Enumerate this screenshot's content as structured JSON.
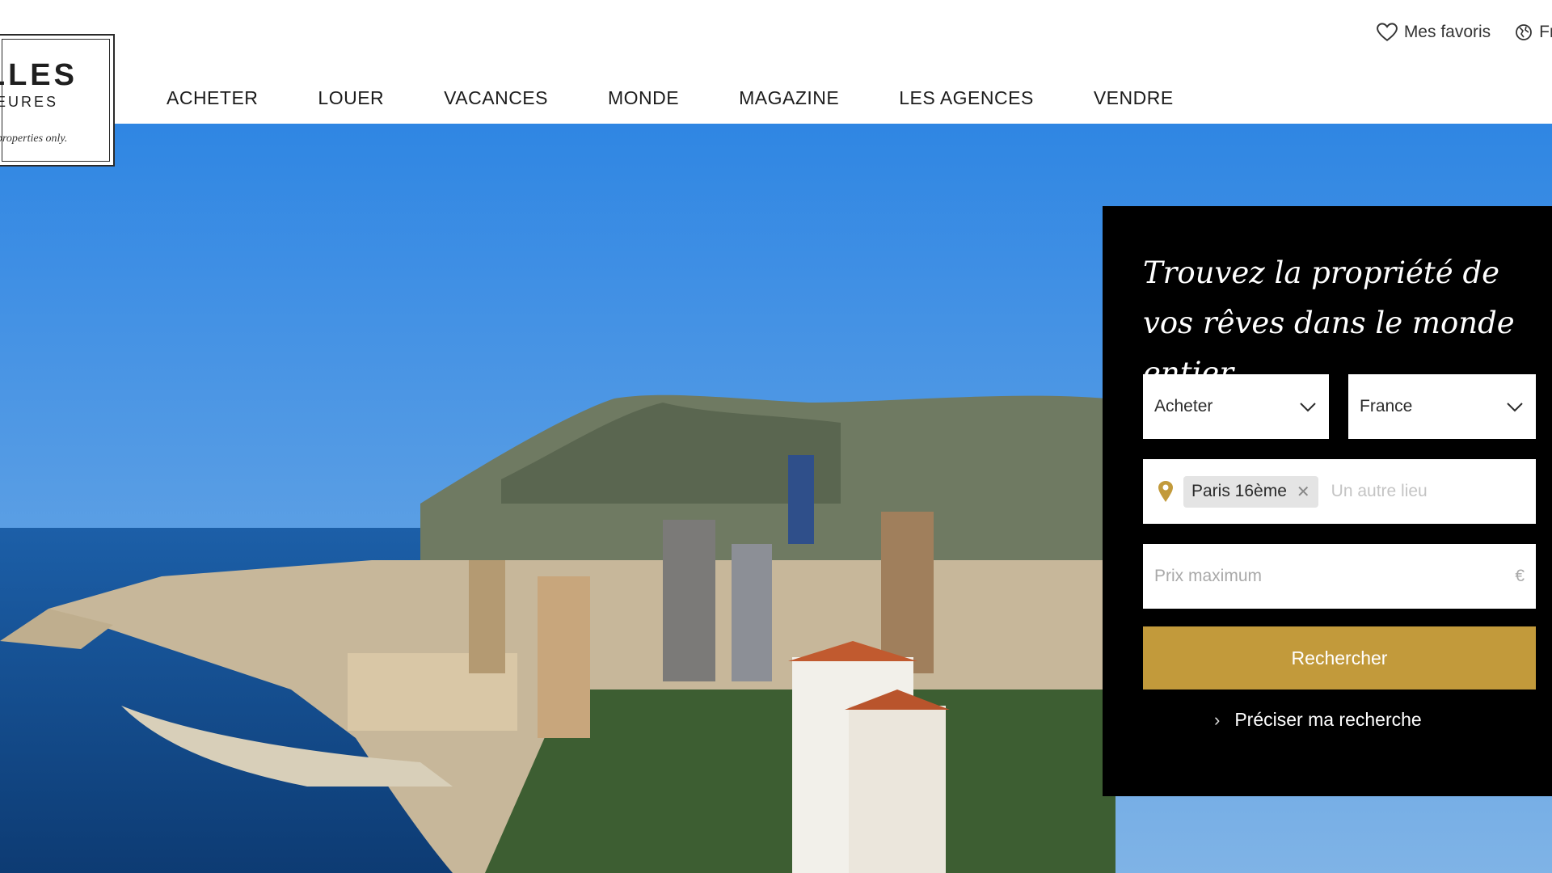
{
  "brand": {
    "word_line1": "LLES",
    "word_line2": "EURES",
    "tagline": "properties only."
  },
  "topbar": {
    "favorites_label": "Mes favoris",
    "language_label": "Fr"
  },
  "nav": {
    "items": [
      "ACHETER",
      "LOUER",
      "VACANCES",
      "MONDE",
      "MAGAZINE",
      "LES AGENCES",
      "VENDRE"
    ]
  },
  "search_panel": {
    "title": "Trouvez la propriété de vos rêves dans le monde entier",
    "transaction_select": "Acheter",
    "country_select": "France",
    "location_chip": "Paris 16ème",
    "location_placeholder": "Un autre lieu",
    "price_placeholder": "Prix maximum",
    "currency_symbol": "€",
    "search_button": "Rechercher",
    "refine_link": "Préciser ma recherche"
  },
  "colors": {
    "accent_gold": "#c29a3b",
    "panel_bg": "#000000"
  },
  "icons": {
    "favorites": "heart-icon",
    "language": "globe-icon",
    "location": "map-pin-icon",
    "dropdown": "chevron-down-icon",
    "remove": "close-icon",
    "refine": "chevron-right-icon"
  }
}
